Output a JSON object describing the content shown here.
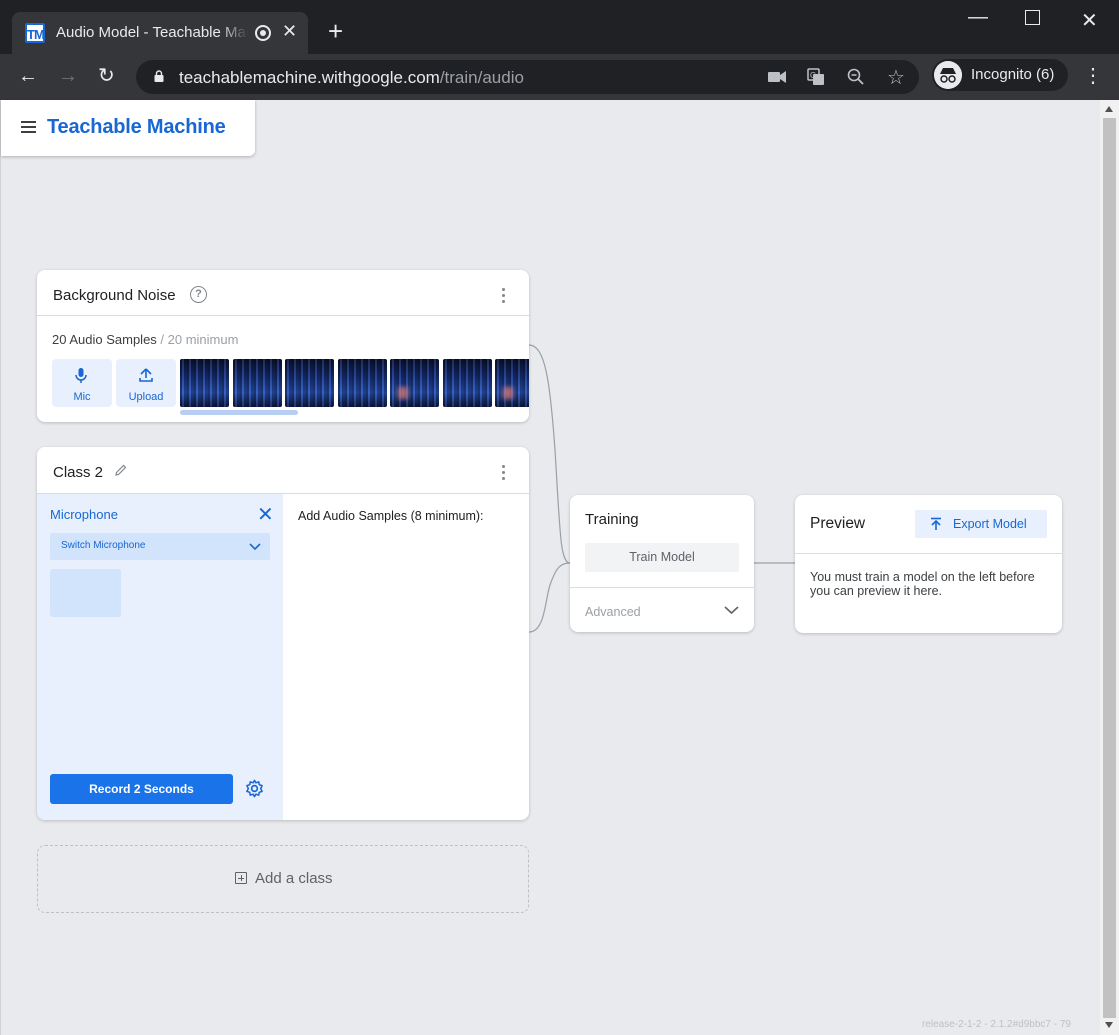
{
  "browser": {
    "tab_title": "Audio Model - Teachable Machine",
    "tab_favicon_text": "TM",
    "url_host": "teachablemachine.withgoogle.com",
    "url_path": "/train/audio",
    "incognito_label": "Incognito (6)"
  },
  "app": {
    "brand": "Teachable Machine"
  },
  "background_card": {
    "title": "Background Noise",
    "samples_count": "20 Audio Samples",
    "samples_min": " / 20 minimum",
    "mic_label": "Mic",
    "upload_label": "Upload"
  },
  "class2_card": {
    "title": "Class 2",
    "microphone_label": "Microphone",
    "switch_microphone": "Switch Microphone",
    "record_button": "Record 2 Seconds",
    "add_samples_label": "Add Audio Samples (8 minimum):"
  },
  "add_class": {
    "label": "Add a class"
  },
  "training": {
    "title": "Training",
    "train_button": "Train Model",
    "advanced_label": "Advanced"
  },
  "preview": {
    "title": "Preview",
    "export_button": "Export Model",
    "message": "You must train a model on the left before you can preview it here."
  },
  "footer": {
    "release": "release-2-1-2 - 2.1.2#d9bbc7 - 79"
  },
  "colors": {
    "accent": "#1a73e8",
    "brand_blue": "#1967d2",
    "page_bg": "#e8eaed",
    "light_blue": "#e8f0fe"
  }
}
